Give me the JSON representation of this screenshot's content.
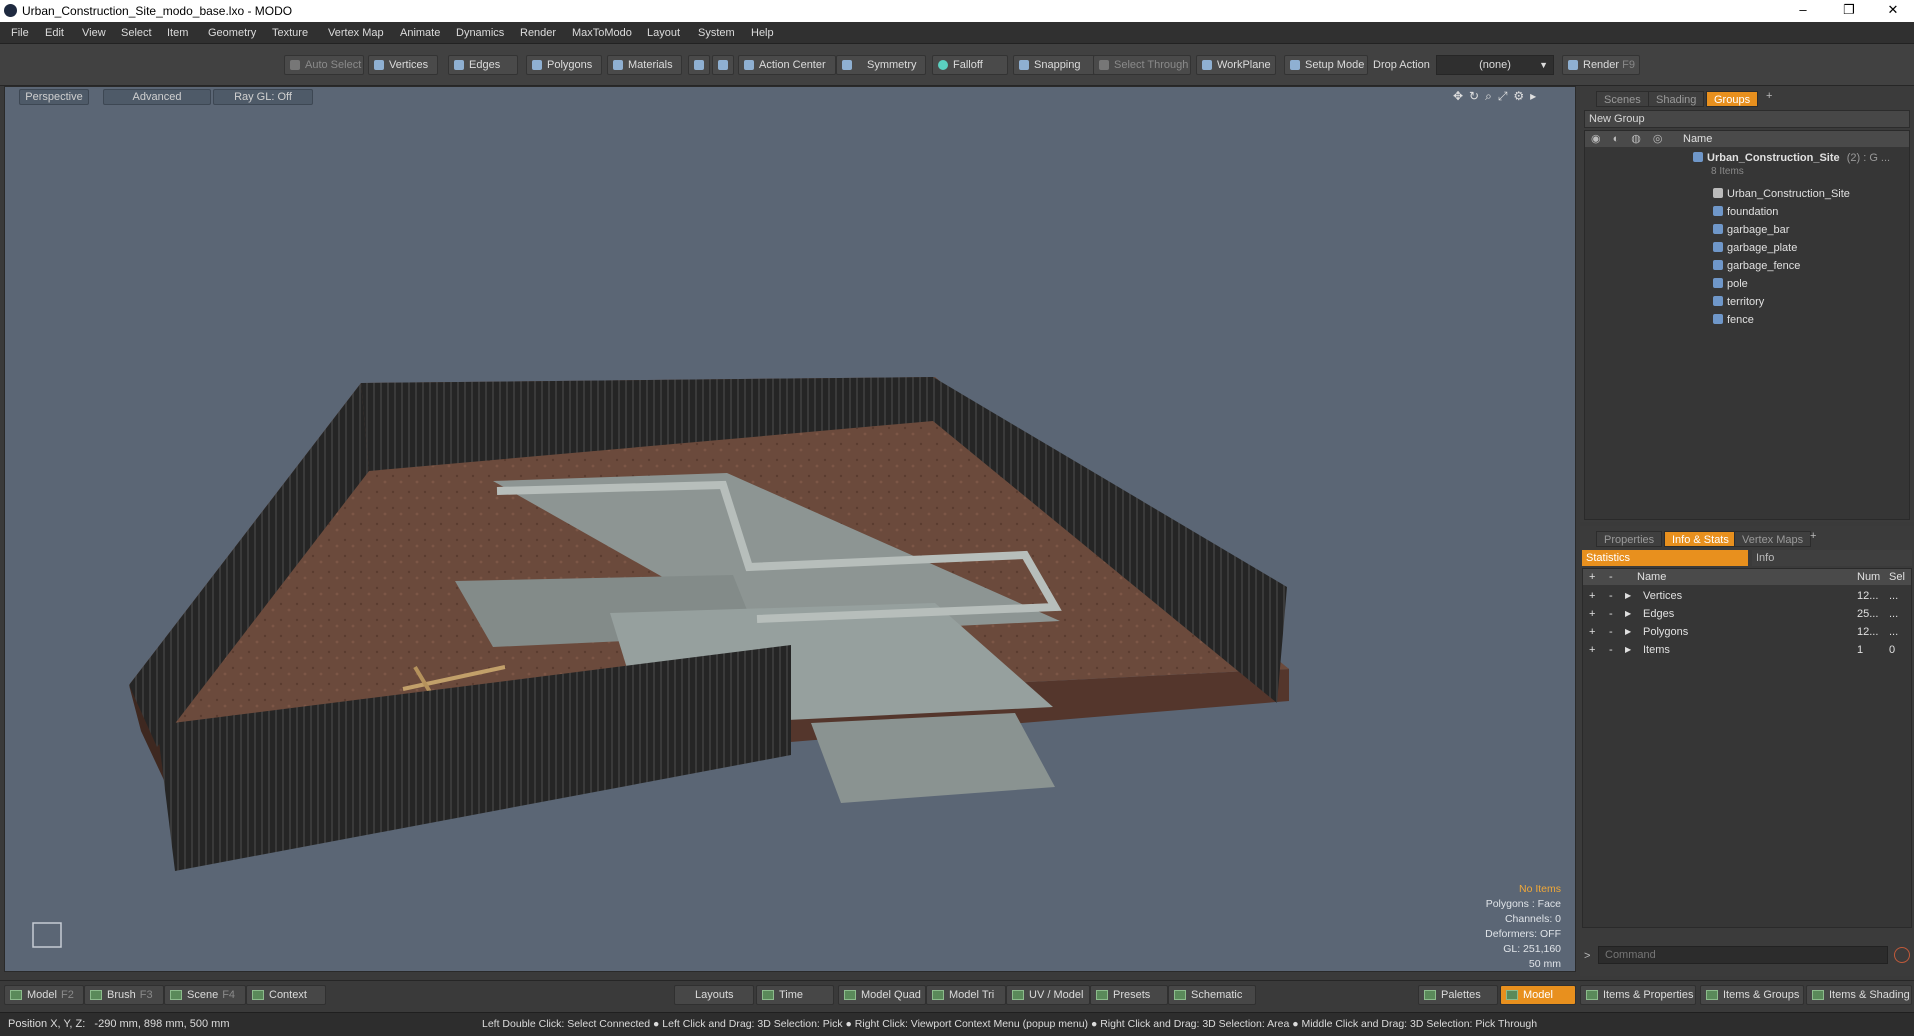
{
  "window": {
    "title": "Urban_Construction_Site_modo_base.lxo - MODO",
    "minimize": "–",
    "maximize": "❐",
    "close": "✕"
  },
  "menu": [
    "File",
    "Edit",
    "View",
    "Select",
    "Item",
    "Geometry",
    "Texture",
    "Vertex Map",
    "Animate",
    "Dynamics",
    "Render",
    "MaxToModo",
    "Layout",
    "System",
    "Help"
  ],
  "toolbar": {
    "auto_select": "Auto Select",
    "vertices": "Vertices",
    "edges": "Edges",
    "polygons": "Polygons",
    "materials": "Materials",
    "action_center": "Action Center",
    "symmetry": "Symmetry",
    "falloff": "Falloff",
    "snapping": "Snapping",
    "select_through": "Select Through",
    "workplane": "WorkPlane",
    "setup_mode": "Setup Mode",
    "drop_action": "Drop Action",
    "drop_value": "(none)",
    "render": "Render",
    "render_key": "F9"
  },
  "viewport": {
    "tabs": [
      "Perspective",
      "Advanced",
      "Ray GL: Off"
    ],
    "info": {
      "selection": "No Items",
      "polygons": "Polygons : Face",
      "channels": "Channels: 0",
      "deformers": "Deformers: OFF",
      "gl": "GL: 251,160",
      "scale": "50 mm"
    },
    "colors": {
      "background": "#5b6675",
      "ground": "#6b4a3c",
      "concrete": "#8e9795",
      "fence": "#2a2a2a"
    }
  },
  "scene_panel": {
    "tabs": [
      "Scenes",
      "Shading",
      "Groups",
      "+"
    ],
    "new_group": "New Group",
    "col_name": "Name",
    "root": {
      "name": "Urban_Construction_Site",
      "suffix": "(2) : G ...",
      "count": "8 Items"
    },
    "items": [
      "Urban_Construction_Site",
      "foundation",
      "garbage_bar",
      "garbage_plate",
      "garbage_fence",
      "pole",
      "territory",
      "fence"
    ]
  },
  "stats_panel": {
    "tabs": [
      "Properties",
      "Info & Stats",
      "Vertex Maps",
      "+"
    ],
    "subtabs": [
      "Statistics",
      "Info"
    ],
    "head": {
      "plus": "+",
      "minus": "-",
      "name": "Name",
      "num": "Num",
      "sel": "Sel"
    },
    "rows": [
      {
        "name": "Vertices",
        "num": "12...",
        "sel": "..."
      },
      {
        "name": "Edges",
        "num": "25...",
        "sel": "..."
      },
      {
        "name": "Polygons",
        "num": "12...",
        "sel": "..."
      },
      {
        "name": "Items",
        "num": "1",
        "sel": "0"
      }
    ],
    "command_placeholder": "Command"
  },
  "bottom": {
    "model": "Model",
    "model_key": "F2",
    "brush": "Brush",
    "brush_key": "F3",
    "scene": "Scene",
    "scene_key": "F4",
    "context": "Context",
    "layouts": "Layouts",
    "time": "Time",
    "model_quad": "Model Quad",
    "model_tri": "Model Tri",
    "uv_model": "UV / Model",
    "presets": "Presets",
    "schematic": "Schematic",
    "palettes": "Palettes",
    "model_active": "Model",
    "items_properties": "Items & Properties",
    "items_groups": "Items & Groups",
    "items_shading": "Items & Shading"
  },
  "status": {
    "position": "Position X, Y, Z:   -290 mm, 898 mm, 500 mm",
    "hints": "Left Double Click: Select Connected ● Left Click and Drag: 3D Selection: Pick ● Right Click: Viewport Context Menu (popup menu) ● Right Click and Drag: 3D Selection: Area ● Middle Click and Drag: 3D Selection: Pick Through"
  }
}
